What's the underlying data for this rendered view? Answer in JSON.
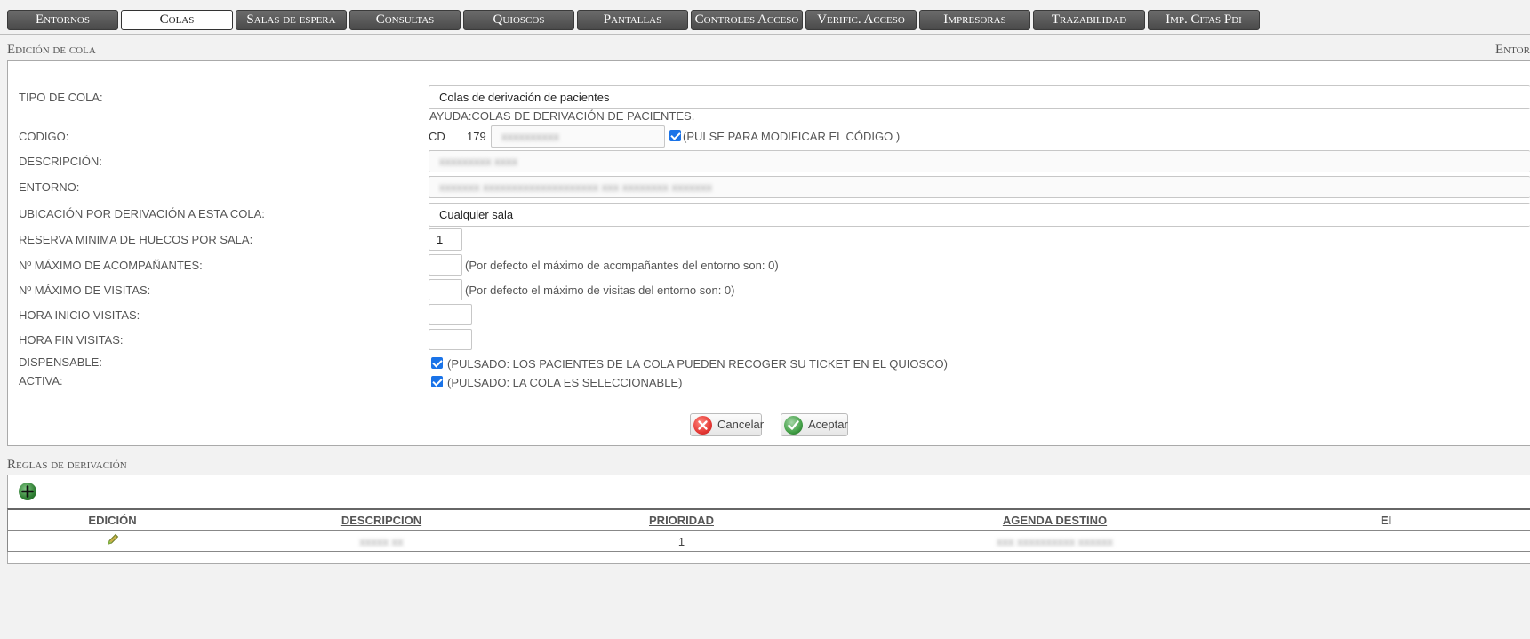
{
  "nav": {
    "tabs": [
      {
        "label": "Entornos"
      },
      {
        "label": "Colas"
      },
      {
        "label": "Salas de espera"
      },
      {
        "label": "Consultas"
      },
      {
        "label": "Quioscos"
      },
      {
        "label": "Pantallas"
      },
      {
        "label": "Controles Acceso"
      },
      {
        "label": "Verific. Acceso"
      },
      {
        "label": "Impresoras"
      },
      {
        "label": "Trazabilidad"
      },
      {
        "label": "Imp. Citas Pdi"
      }
    ],
    "active_tab": "Colas"
  },
  "edit_section": {
    "title": "Edición de cola",
    "right_title": "Entor",
    "tipo_cola": {
      "label": "TIPO DE COLA:",
      "value": "Colas de derivación de pacientes",
      "help": "AYUDA:COLAS DE DERIVACIÓN DE PACIENTES."
    },
    "codigo": {
      "label": "CODIGO:",
      "prefix": "CD",
      "number": "179",
      "value": "xxxxxxxxxx",
      "note": "(PULSE PARA MODIFICAR EL CÓDIGO )"
    },
    "descripcion": {
      "label": "DESCRIPCIÓN:",
      "value": "xxxxxxxxx xxxx"
    },
    "entorno": {
      "label": "ENTORNO:",
      "value": "xxxxxxx xxxxxxxxxxxxxxxxxxxx  xxx xxxxxxxx xxxxxxx"
    },
    "ubicacion": {
      "label": "UBICACIÓN POR DERIVACIÓN A ESTA COLA:",
      "value": "Cualquier sala"
    },
    "reserva": {
      "label": "RESERVA MINIMA DE HUECOS POR SALA:",
      "value": "1"
    },
    "acompanantes": {
      "label": "Nº MÁXIMO DE ACOMPAÑANTES:",
      "value": "",
      "note": "(Por defecto el máximo de acompañantes del entorno son: 0)"
    },
    "visitas": {
      "label": "Nº MÁXIMO DE VISITAS:",
      "value": "",
      "note": "(Por defecto el máximo de visitas del entorno son: 0)"
    },
    "hora_inicio": {
      "label": "HORA INICIO VISITAS:",
      "value": ""
    },
    "hora_fin": {
      "label": "HORA FIN VISITAS:",
      "value": ""
    },
    "dispensable": {
      "label": "DISPENSABLE:",
      "checked": true,
      "note": "(PULSADO: LOS PACIENTES DE LA COLA PUEDEN RECOGER SU TICKET EN EL QUIOSCO)"
    },
    "activa": {
      "label": "ACTIVA:",
      "checked": true,
      "note": "(PULSADO: LA COLA ES SELECCIONABLE)"
    },
    "cancel_label": "Cancelar",
    "accept_label": "Aceptar"
  },
  "rules_section": {
    "title": "Reglas de derivación",
    "headers": [
      "EDICIÓN",
      "DESCRIPCION",
      "PRIORIDAD",
      "AGENDA DESTINO",
      "EI"
    ],
    "rows": [
      {
        "descripcion": "xxxxx xx",
        "prioridad": "1",
        "agenda": "xxx xxxxxxxxxx xxxxxx"
      }
    ]
  },
  "colors": {
    "accent_check": "#1a73e8",
    "cancel_icon": "#e53935",
    "accept_icon": "#43a047",
    "add_icon": "#2e7d32"
  }
}
